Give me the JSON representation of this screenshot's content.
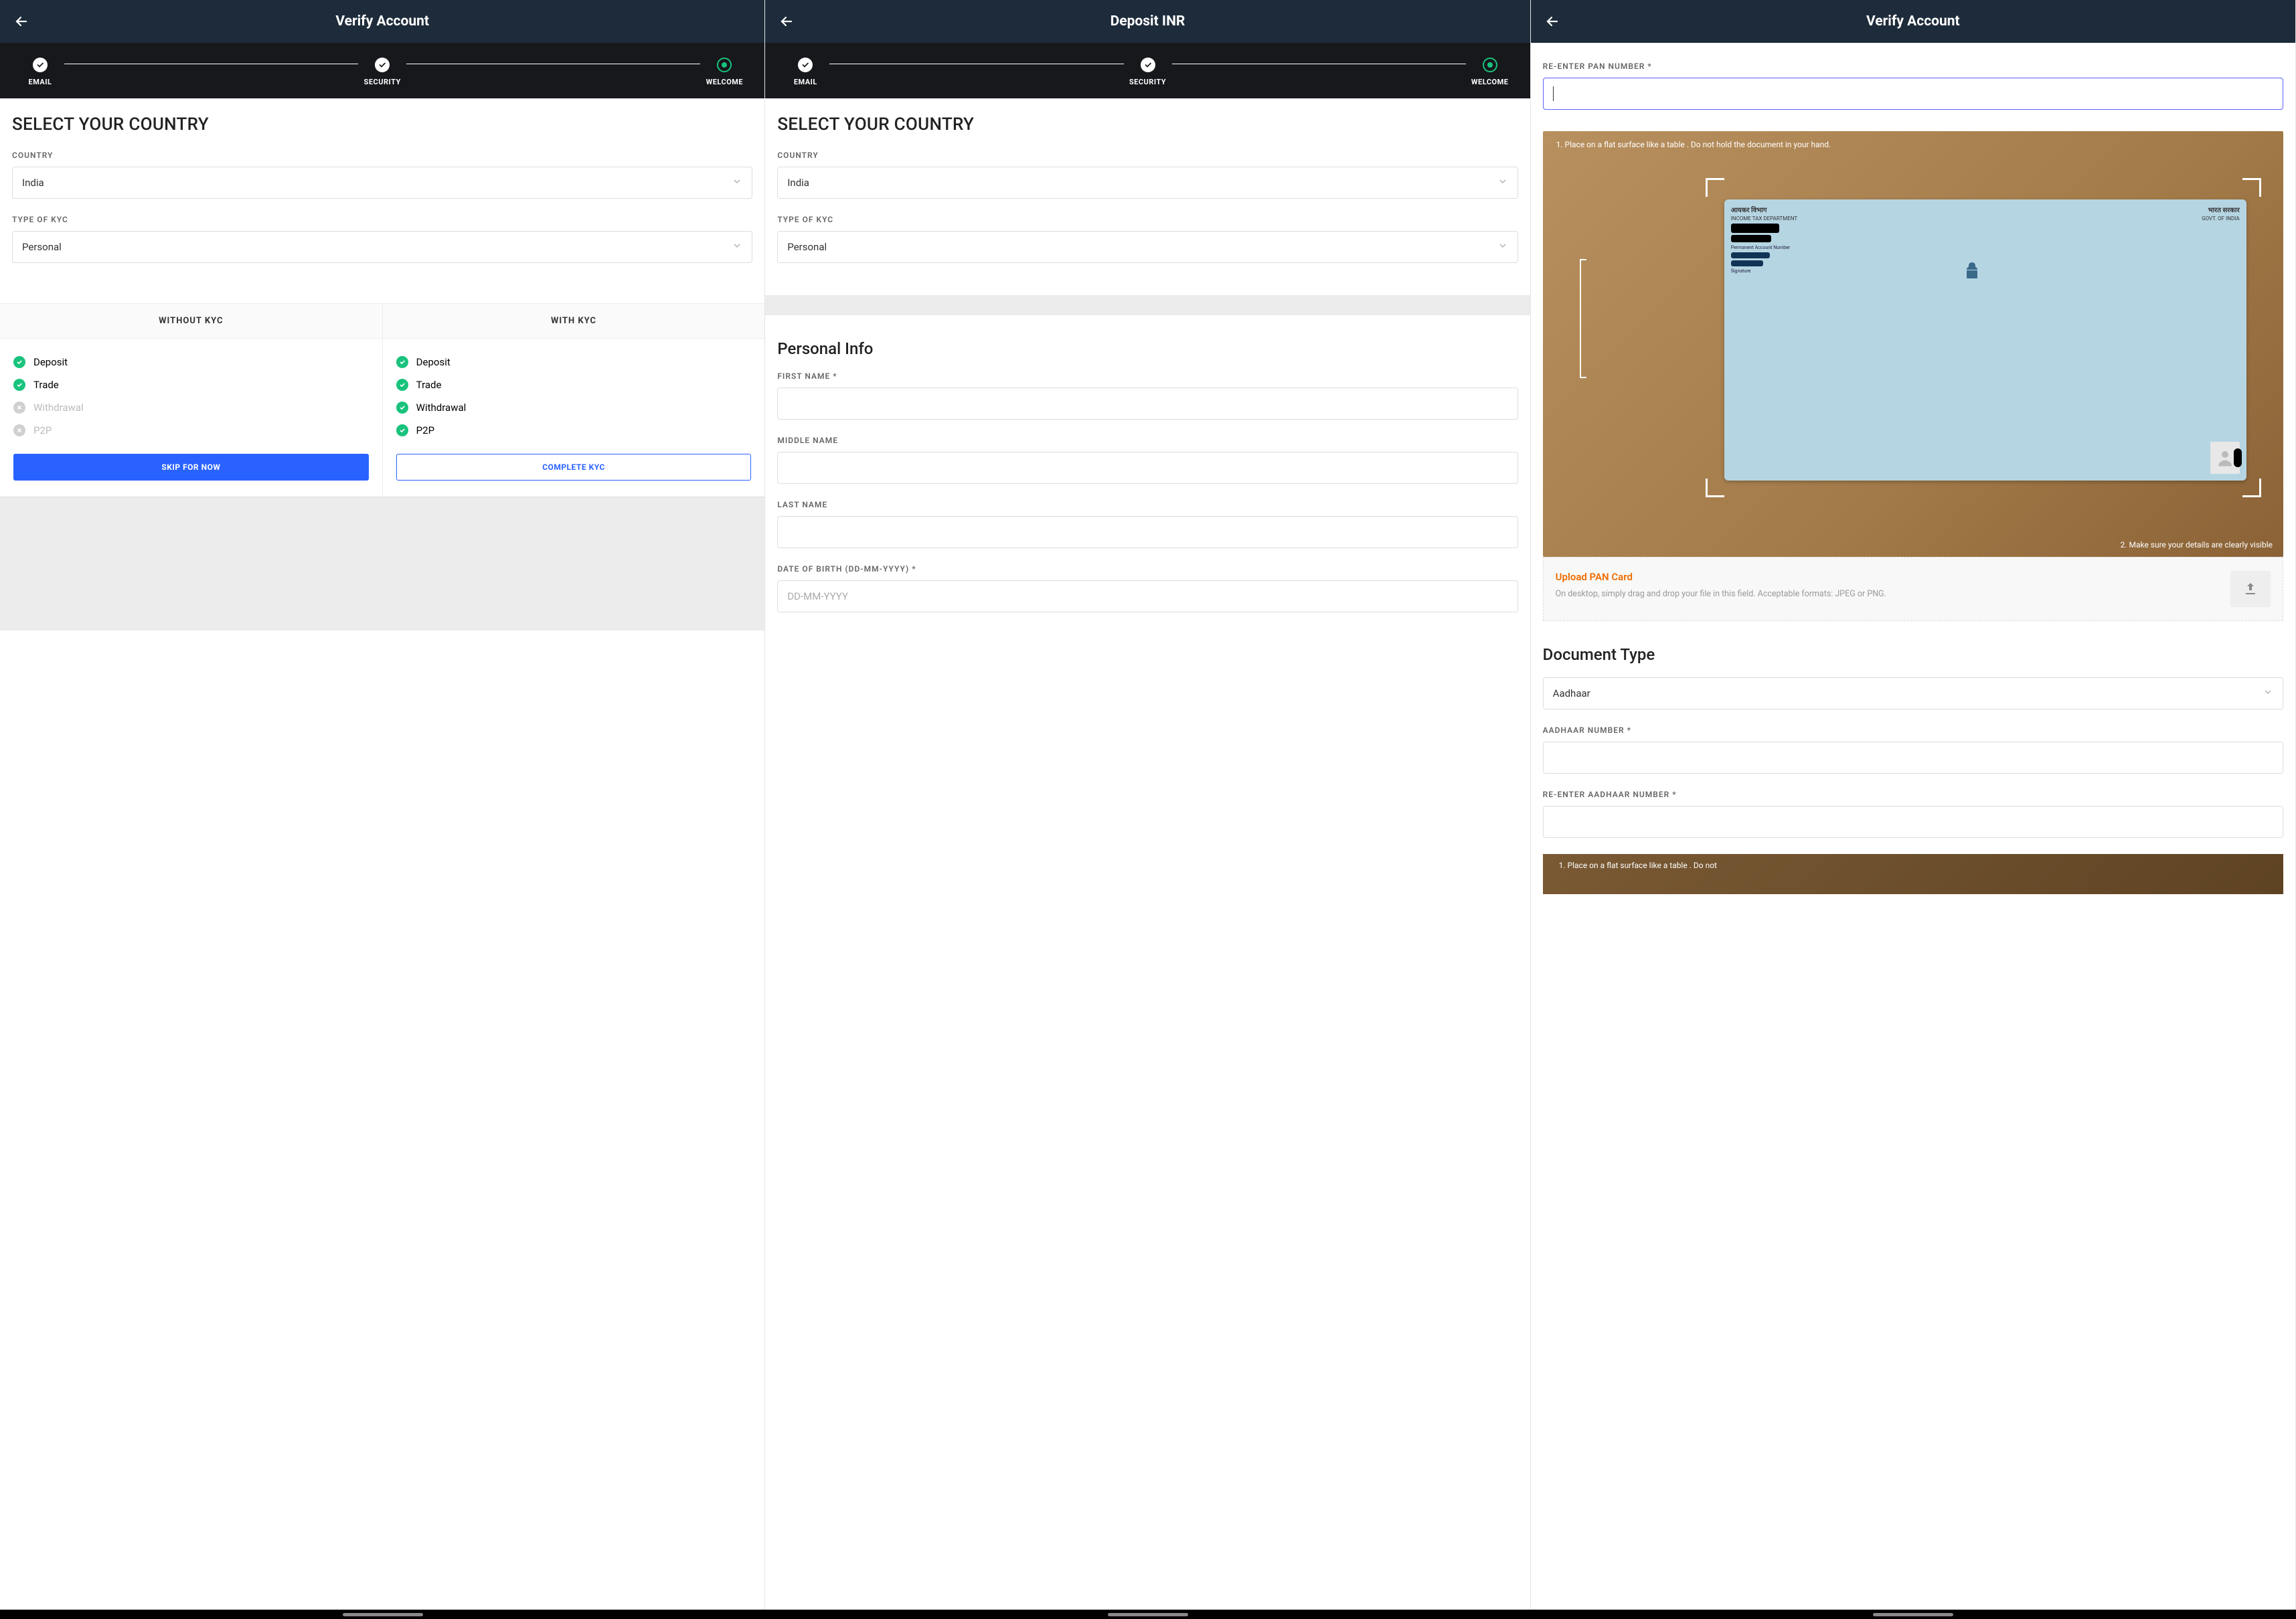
{
  "screen1": {
    "title": "Verify Account",
    "steps": [
      "EMAIL",
      "SECURITY",
      "WELCOME"
    ],
    "heading": "SELECT YOUR COUNTRY",
    "country_label": "COUNTRY",
    "country_value": "India",
    "kyc_type_label": "TYPE OF KYC",
    "kyc_type_value": "Personal",
    "without_kyc_header": "WITHOUT KYC",
    "with_kyc_header": "WITH KYC",
    "features": {
      "deposit": "Deposit",
      "trade": "Trade",
      "withdrawal": "Withdrawal",
      "p2p": "P2P"
    },
    "skip_btn": "SKIP FOR NOW",
    "complete_btn": "COMPLETE KYC"
  },
  "screen2": {
    "title": "Deposit INR",
    "steps": [
      "EMAIL",
      "SECURITY",
      "WELCOME"
    ],
    "heading": "SELECT YOUR COUNTRY",
    "country_label": "COUNTRY",
    "country_value": "India",
    "kyc_type_label": "TYPE OF KYC",
    "kyc_type_value": "Personal",
    "personal_info_heading": "Personal Info",
    "first_name_label": "FIRST NAME *",
    "middle_name_label": "MIDDLE NAME",
    "last_name_label": "LAST NAME",
    "dob_label": "DATE OF BIRTH (DD-MM-YYYY) *",
    "dob_placeholder": "DD-MM-YYYY"
  },
  "screen3": {
    "title": "Verify Account",
    "pan_label": "RE-ENTER PAN NUMBER *",
    "tip1": "1. Place on a flat surface like a table . Do not hold the document in your hand.",
    "tip2": "2. Make sure your details are clearly visible",
    "card": {
      "top_left_hi": "आयकर विभाग",
      "top_right_hi": "भारत सरकार",
      "top_left_en": "INCOME TAX DEPARTMENT",
      "top_right_en": "GOVT. OF INDIA",
      "perm_label": "Permanent Account Number",
      "sig_label": "Signature"
    },
    "upload_title": "Upload PAN Card",
    "upload_sub": "On desktop, simply drag and drop your file in this field. Acceptable formats: JPEG or PNG.",
    "doc_type_heading": "Document Type",
    "doc_type_value": "Aadhaar",
    "aadhaar_label": "AADHAAR NUMBER *",
    "re_aadhaar_label": "RE-ENTER AADHAAR NUMBER *",
    "aadhaar_tip": "1. Place on a flat surface like a table . Do not"
  }
}
